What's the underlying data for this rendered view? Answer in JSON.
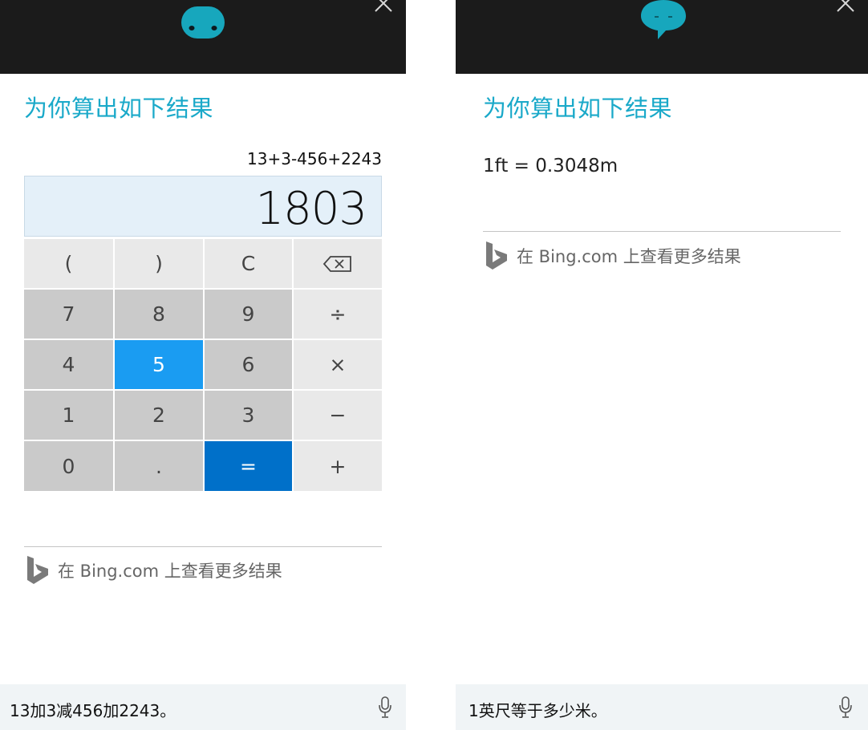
{
  "left_panel": {
    "heading": "为你算出如下结果",
    "calculator": {
      "expression": "13+3-456+2243",
      "result": "1803",
      "keys": [
        {
          "label": "(",
          "style": "light",
          "name": "key-open-paren"
        },
        {
          "label": ")",
          "style": "light",
          "name": "key-close-paren"
        },
        {
          "label": "C",
          "style": "light",
          "name": "key-clear"
        },
        {
          "label": "",
          "style": "light",
          "name": "key-backspace",
          "icon": "backspace-icon"
        },
        {
          "label": "7",
          "style": "dark",
          "name": "key-7"
        },
        {
          "label": "8",
          "style": "dark",
          "name": "key-8"
        },
        {
          "label": "9",
          "style": "dark",
          "name": "key-9"
        },
        {
          "label": "÷",
          "style": "light",
          "name": "key-divide"
        },
        {
          "label": "4",
          "style": "dark",
          "name": "key-4"
        },
        {
          "label": "5",
          "style": "pressed",
          "name": "key-5"
        },
        {
          "label": "6",
          "style": "dark",
          "name": "key-6"
        },
        {
          "label": "×",
          "style": "light",
          "name": "key-multiply"
        },
        {
          "label": "1",
          "style": "dark",
          "name": "key-1"
        },
        {
          "label": "2",
          "style": "dark",
          "name": "key-2"
        },
        {
          "label": "3",
          "style": "dark",
          "name": "key-3"
        },
        {
          "label": "−",
          "style": "light",
          "name": "key-subtract"
        },
        {
          "label": "0",
          "style": "dark",
          "name": "key-0"
        },
        {
          "label": ".",
          "style": "dark",
          "name": "key-decimal"
        },
        {
          "label": "=",
          "style": "equals",
          "name": "key-equals"
        },
        {
          "label": "+",
          "style": "light",
          "name": "key-add"
        }
      ]
    },
    "bing_link": "在 Bing.com 上查看更多结果",
    "query": "13加3减456加2243。",
    "mascot_icon": "cortana-face-icon"
  },
  "right_panel": {
    "heading": "为你算出如下结果",
    "result": "1ft = 0.3048m",
    "bing_link": "在 Bing.com 上查看更多结果",
    "query": "1英尺等于多少米。",
    "mascot_icon": "cortana-speech-bubble-icon"
  },
  "colors": {
    "accent": "#1aa9c9",
    "topbar": "#1b1b1b",
    "key_pressed": "#1a9cf2",
    "key_equals": "#0070c9",
    "display_bg": "#e4f0f9"
  }
}
